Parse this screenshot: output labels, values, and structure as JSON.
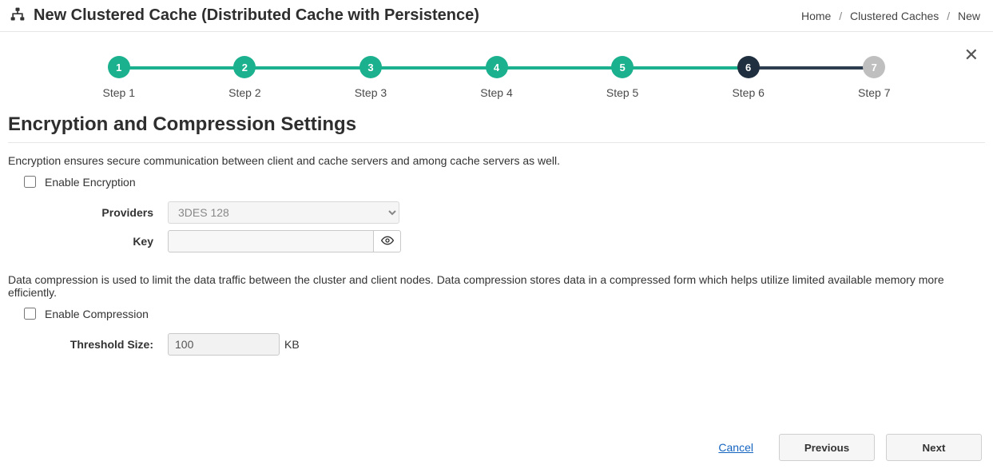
{
  "header": {
    "title": "New Clustered Cache (Distributed Cache with Persistence)"
  },
  "breadcrumb": {
    "items": [
      "Home",
      "Clustered Caches",
      "New"
    ]
  },
  "stepper": {
    "steps": [
      {
        "num": "1",
        "label": "Step 1",
        "state": "done"
      },
      {
        "num": "2",
        "label": "Step 2",
        "state": "done"
      },
      {
        "num": "3",
        "label": "Step 3",
        "state": "done"
      },
      {
        "num": "4",
        "label": "Step 4",
        "state": "done"
      },
      {
        "num": "5",
        "label": "Step 5",
        "state": "done"
      },
      {
        "num": "6",
        "label": "Step 6",
        "state": "active"
      },
      {
        "num": "7",
        "label": "Step 7",
        "state": "future"
      }
    ]
  },
  "section": {
    "title": "Encryption and Compression Settings",
    "encryption_desc": "Encryption ensures secure communication between client and cache servers and among cache servers as well.",
    "compression_desc": "Data compression is used to limit the data traffic between the cluster and client nodes. Data compression stores data in a compressed form which helps utilize limited available memory more efficiently."
  },
  "encryption": {
    "enable_label": "Enable Encryption",
    "providers_label": "Providers",
    "provider_value": "3DES 128",
    "key_label": "Key",
    "key_value": ""
  },
  "compression": {
    "enable_label": "Enable Compression",
    "threshold_label": "Threshold Size:",
    "threshold_value": "100",
    "threshold_unit": "KB"
  },
  "footer": {
    "cancel": "Cancel",
    "previous": "Previous",
    "next": "Next"
  }
}
